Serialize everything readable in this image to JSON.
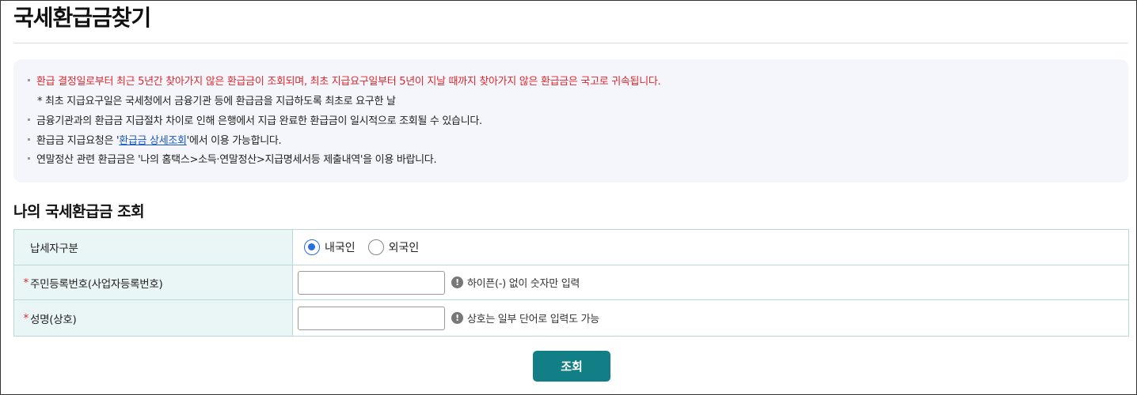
{
  "page": {
    "title": "국세환급금찾기"
  },
  "notice": {
    "line1": "환급 결정일로부터 최근 5년간 찾아가지 않은 환급금이 조회되며, 최초 지급요구일부터 5년이 지날 때까지 찾아가지 않은 환급금은 국고로 귀속됩니다.",
    "line2": "* 최초 지급요구일은 국세청에서 금융기관 등에 환급금을 지급하도록 최초로 요구한 날",
    "line3": "금융기관과의 환급금 지급절차 차이로 인해 은행에서 지급 완료한 환급금이 일시적으로 조회될 수 있습니다.",
    "line4_prefix": "환급금 지급요청은 '",
    "line4_link": "환급금 상세조회",
    "line4_suffix": "'에서 이용 가능합니다.",
    "line5": "연말정산 관련 환급금은 '나의 홈택스>소득·연말정산>지급명세서등 제출내역'을 이용 바랍니다.",
    "line1_color": "#e0262b",
    "link_color": "#1a56c6"
  },
  "section": {
    "title": "나의 국세환급금 조회"
  },
  "form": {
    "taxpayer_type": {
      "label": "납세자구분",
      "options": [
        {
          "label": "내국인",
          "checked": true
        },
        {
          "label": "외국인",
          "checked": false
        }
      ]
    },
    "resident_number": {
      "required_mark": "*",
      "label": "주민등록번호(사업자등록번호)",
      "value": "",
      "placeholder": "",
      "hint": "하이픈(-) 없이 숫자만 입력"
    },
    "name": {
      "required_mark": "*",
      "label": "성명(상호)",
      "value": "",
      "placeholder": "",
      "hint": "상호는 일부 단어로 입력도 가능"
    },
    "info_icon_glyph": "!"
  },
  "actions": {
    "search_label": "조회",
    "search_color": "#127f87"
  }
}
